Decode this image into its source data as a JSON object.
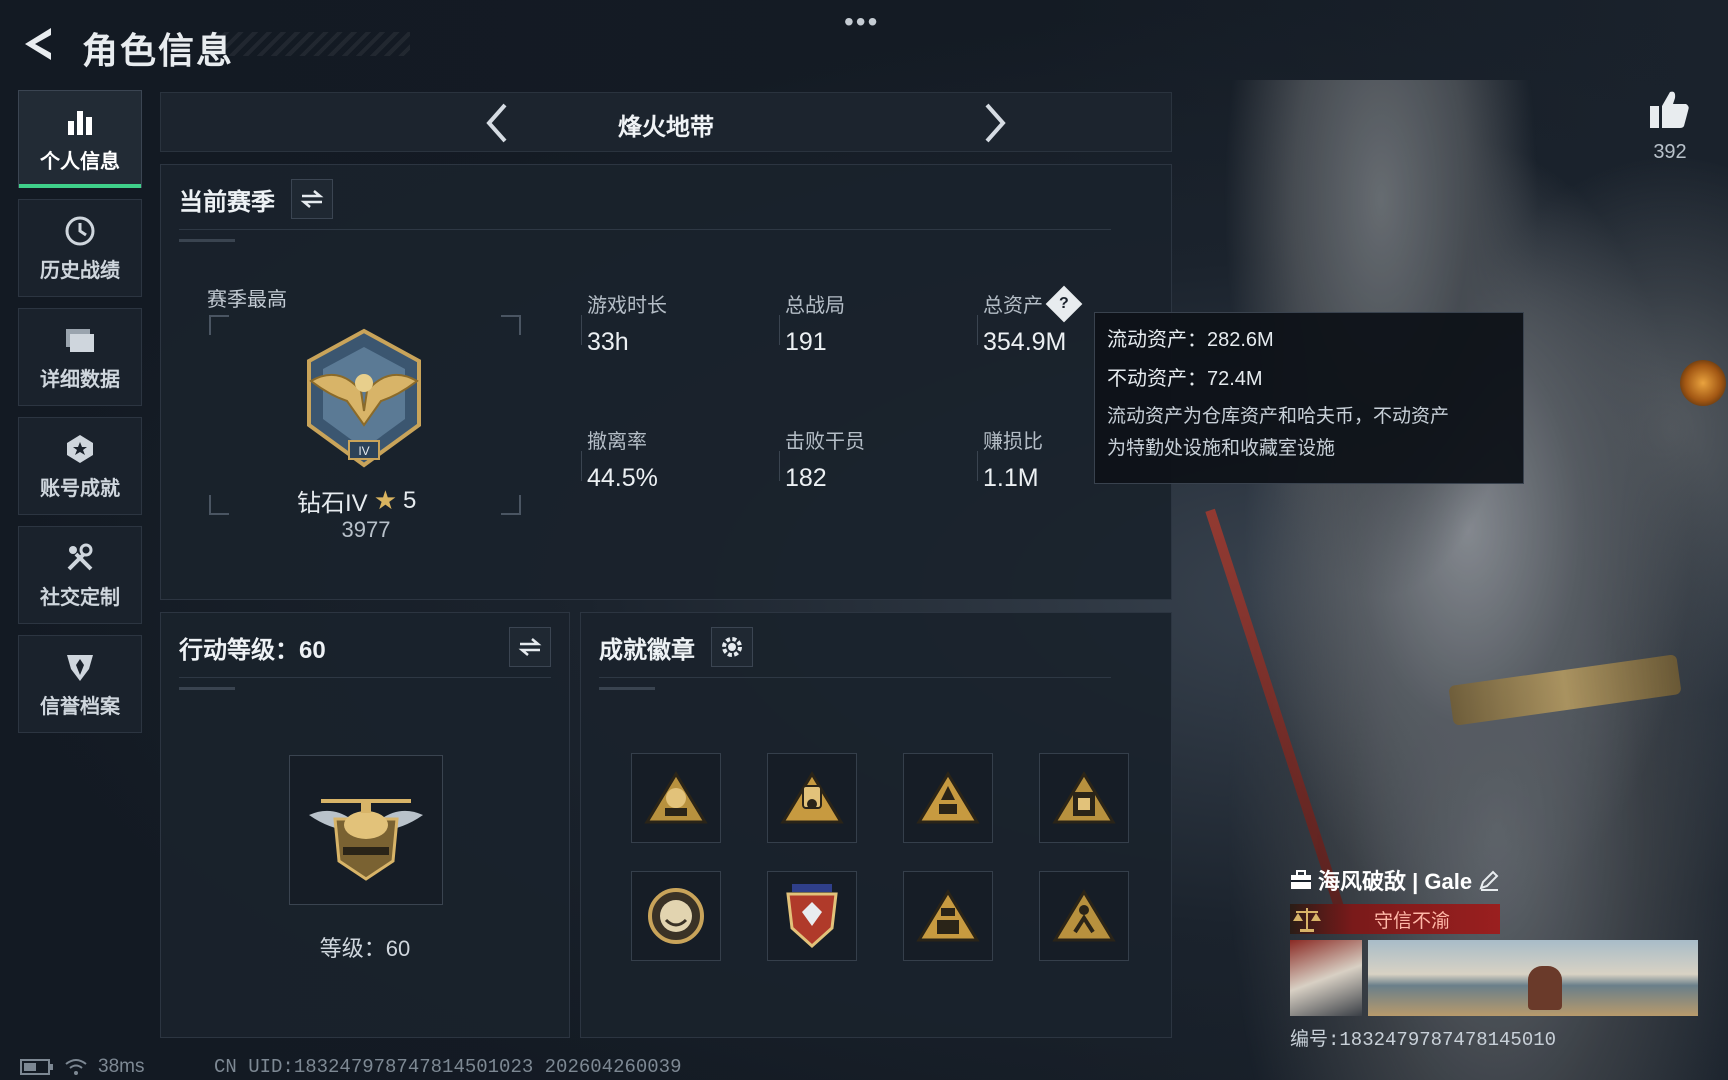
{
  "header": {
    "title": "角色信息",
    "more": "•••"
  },
  "sidebar": {
    "items": [
      {
        "label": "个人信息",
        "icon": "bar-chart-icon",
        "active": true
      },
      {
        "label": "历史战绩",
        "icon": "history-clock-icon",
        "active": false
      },
      {
        "label": "详细数据",
        "icon": "folder-icon",
        "active": false
      },
      {
        "label": "账号成就",
        "icon": "achievement-medal-icon",
        "active": false
      },
      {
        "label": "社交定制",
        "icon": "tools-icon",
        "active": false
      },
      {
        "label": "信誉档案",
        "icon": "credit-shield-icon",
        "active": false
      }
    ]
  },
  "mode": {
    "title": "烽火地带"
  },
  "season": {
    "title": "当前赛季",
    "best_label": "赛季最高",
    "rank_name": "钻石IV",
    "rank_stars": "5",
    "rank_points": "3977",
    "stats": [
      {
        "label": "游戏时长",
        "value": "33h"
      },
      {
        "label": "总战局",
        "value": "191"
      },
      {
        "label": "总资产",
        "value": "354.9M"
      },
      {
        "label": "撤离率",
        "value": "44.5%"
      },
      {
        "label": "击败干员",
        "value": "182"
      },
      {
        "label": "赚损比",
        "value": "1.1M"
      }
    ],
    "help_glyph": "?"
  },
  "tooltip": {
    "liquid": "流动资产：282.6M",
    "fixed": "不动资产：72.4M",
    "note_line1": "流动资产为仓库资产和哈夫币，不动资产",
    "note_line2": "为特勤处设施和收藏室设施"
  },
  "action_level": {
    "title": "行动等级：60",
    "level_text": "等级：60"
  },
  "badges": {
    "title": "成就徽章",
    "items": [
      {
        "icon": "badge-s4-icon"
      },
      {
        "icon": "badge-s5-icon"
      },
      {
        "icon": "badge-s6-icon"
      },
      {
        "icon": "badge-gate-icon"
      },
      {
        "icon": "badge-orb-icon"
      },
      {
        "icon": "badge-shield-icon"
      },
      {
        "icon": "badge-triangle-icon"
      },
      {
        "icon": "badge-runner-icon"
      }
    ]
  },
  "like": {
    "count": "392"
  },
  "status": {
    "latency": "38ms",
    "uid_line": "CN UID:183247978747814501023 202604260039"
  },
  "namecard": {
    "name": "海风破敌 | Gale",
    "motto": "守信不渝",
    "id": "编号:1832479787478145010"
  },
  "colors": {
    "accent_green": "#3fd08a",
    "gold": "#d9b460",
    "motto_red": "#9a1f1f"
  }
}
